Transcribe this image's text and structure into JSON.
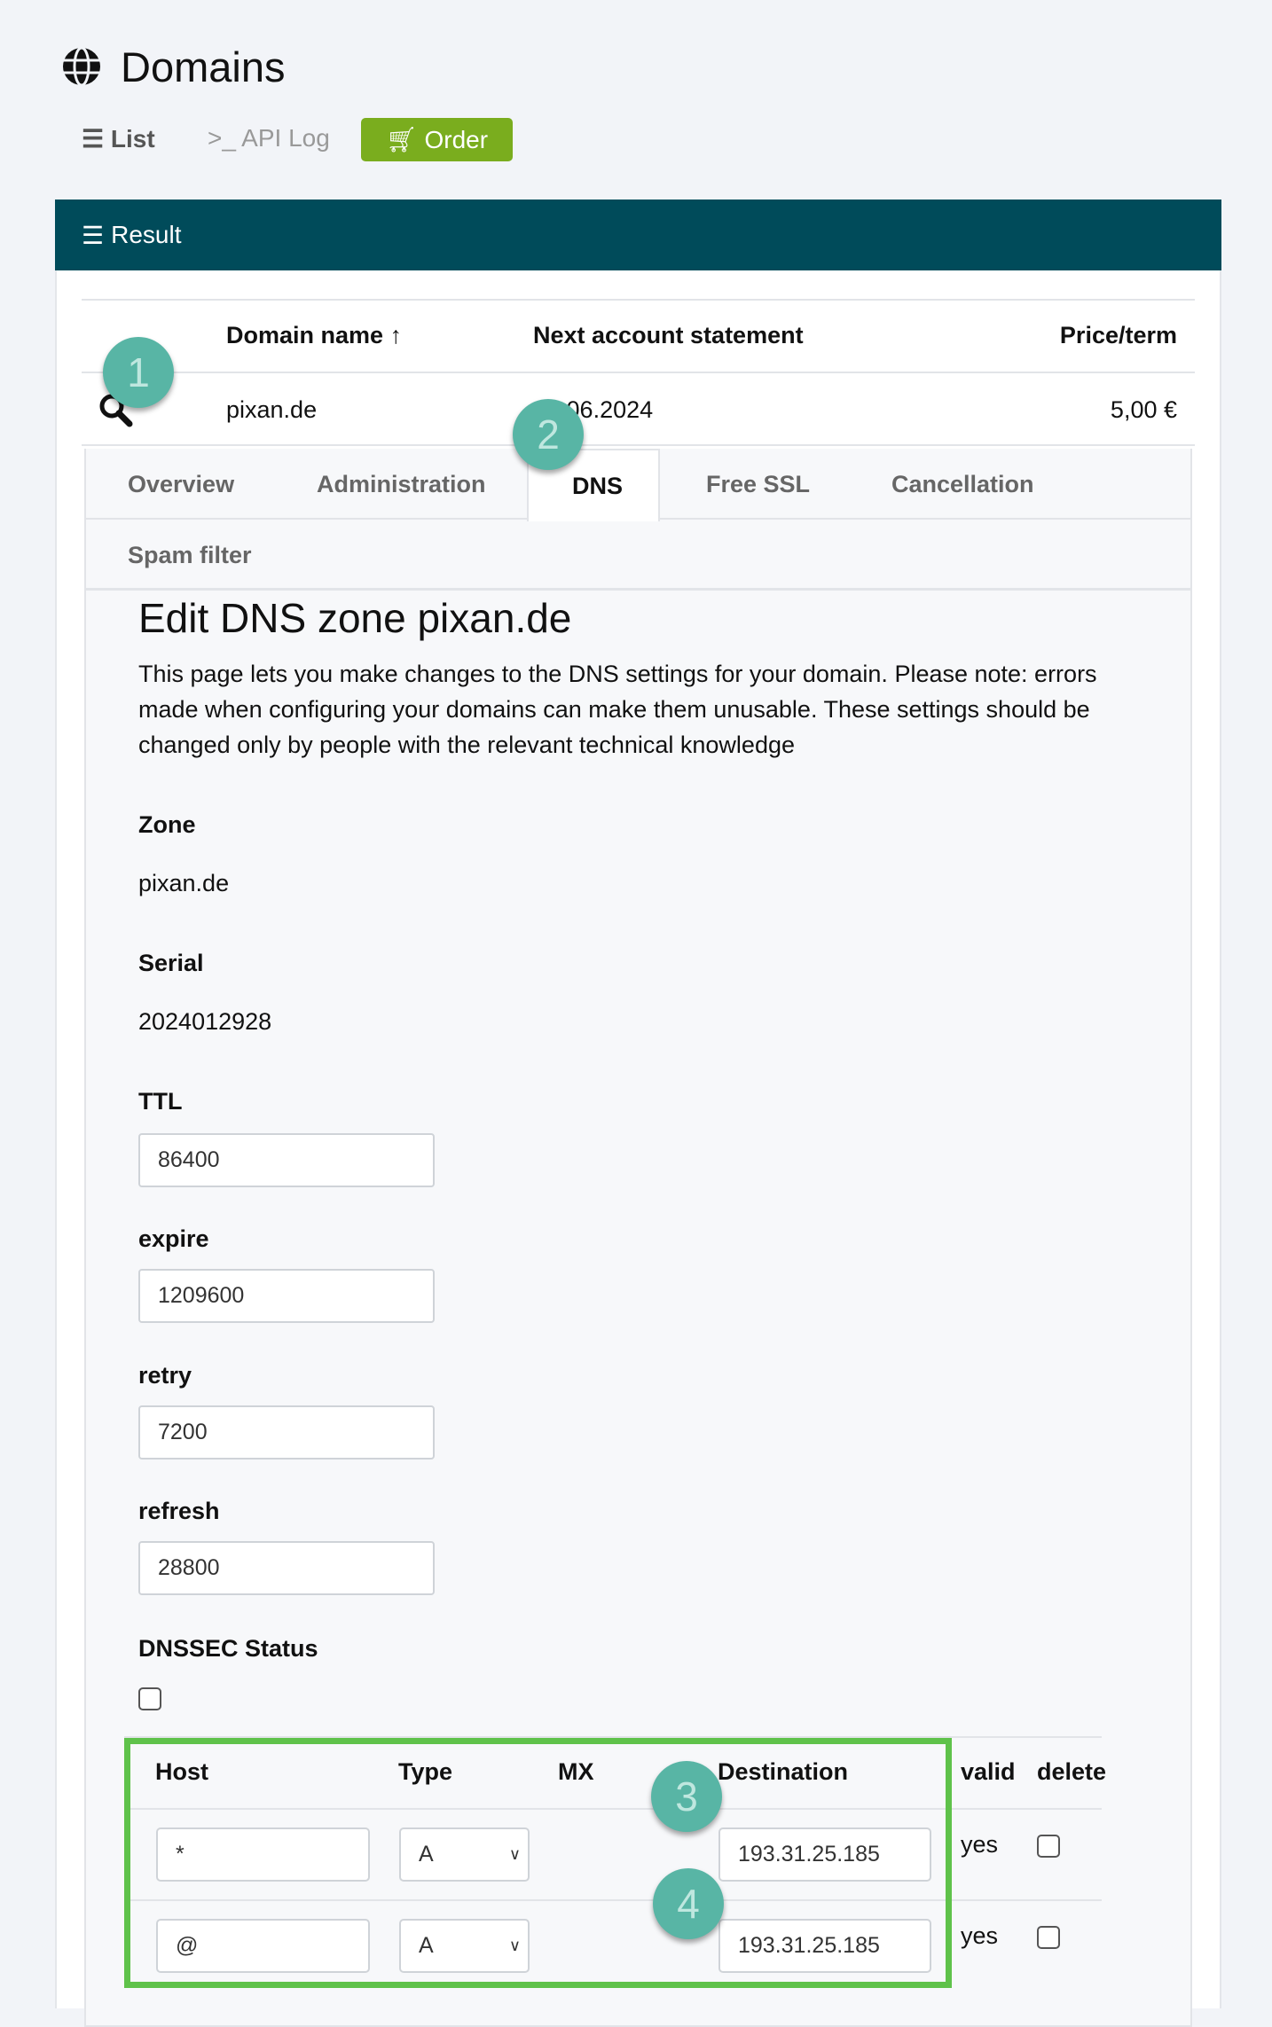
{
  "header": {
    "title": "Domains",
    "icon": "globe-icon"
  },
  "nav": {
    "list": "List",
    "api_log": "API Log",
    "order": "Order"
  },
  "result": {
    "title": "Result"
  },
  "domain_table": {
    "headers": [
      "Domain name",
      "Next account statement",
      "Price/term"
    ],
    "sort": "ascending",
    "row": {
      "domain": "pixan.de",
      "next_statement": "05.06.2024",
      "price": "5,00 €"
    }
  },
  "tabs": [
    {
      "label": "Overview"
    },
    {
      "label": "Administration"
    },
    {
      "label": "DNS",
      "active": true
    },
    {
      "label": "Free SSL"
    },
    {
      "label": "Cancellation"
    },
    {
      "label": "Spam filter"
    }
  ],
  "dns": {
    "heading": "Edit DNS zone pixan.de",
    "description": "This page lets you make changes to the DNS settings for your domain. Please note: errors made when configuring your domains can make them unusable. These settings should be changed only by people with the relevant technical knowledge",
    "zone_label": "Zone",
    "zone": "pixan.de",
    "serial_label": "Serial",
    "serial": "2024012928",
    "ttl_label": "TTL",
    "ttl": "86400",
    "expire_label": "expire",
    "expire": "1209600",
    "retry_label": "retry",
    "retry": "7200",
    "refresh_label": "refresh",
    "refresh": "28800",
    "dnssec_label": "DNSSEC Status",
    "dnssec_checked": false,
    "records_headers": [
      "Host",
      "Type",
      "MX",
      "Destination",
      "valid",
      "delete"
    ],
    "records": [
      {
        "host": "*",
        "type": "A",
        "destination": "193.31.25.185",
        "valid": "yes"
      },
      {
        "host": "@",
        "type": "A",
        "destination": "193.31.25.185",
        "valid": "yes"
      }
    ]
  },
  "badges": [
    "1",
    "2",
    "3",
    "4"
  ],
  "colors": {
    "header_bar": "#004b5a",
    "order_button": "#7aad1e",
    "highlight_box": "#5fc24a",
    "badge": "#58b5a5"
  }
}
